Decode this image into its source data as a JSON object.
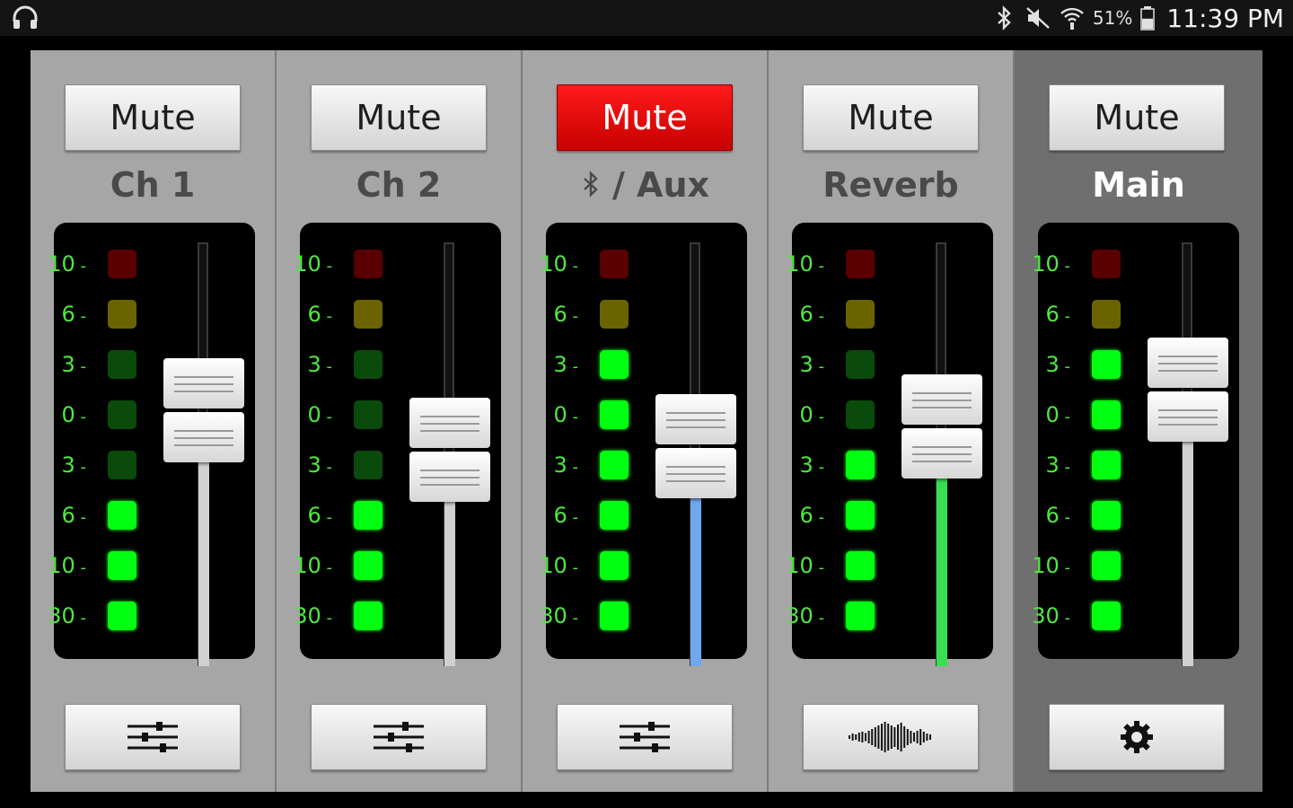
{
  "status_bar": {
    "left_icon": "headphones-icon",
    "right_icons": [
      "bluetooth-icon",
      "mute-speaker-icon",
      "wifi-icon"
    ],
    "battery_percent": "51%",
    "battery_level": 0.51,
    "time": "11:39 PM"
  },
  "meter_scale": [
    "10",
    "6",
    "3",
    "0",
    "3",
    "6",
    "10",
    "30"
  ],
  "colors": {
    "led_red_off": "#5a0000",
    "led_yellow_off": "#6b6300",
    "led_green_off": "#0a4a0a",
    "led_green_on": "#00ff10",
    "mute_active": "#e80000",
    "aux_fill": "#6fa8ee",
    "reverb_fill": "#37e04f",
    "gray_fill": "#d0d0d0"
  },
  "channels": [
    {
      "id": "ch1",
      "mute_label": "Mute",
      "muted": false,
      "label": "Ch 1",
      "leds_lit": [
        false,
        false,
        false,
        false,
        false,
        true,
        true,
        true
      ],
      "fader_level": 0.62,
      "fill_color": "gray",
      "tool_icon": "eq-sliders-icon"
    },
    {
      "id": "ch2",
      "mute_label": "Mute",
      "muted": false,
      "label": "Ch 2",
      "leds_lit": [
        false,
        false,
        false,
        false,
        false,
        true,
        true,
        true
      ],
      "fader_level": 0.5,
      "fill_color": "gray",
      "tool_icon": "eq-sliders-icon"
    },
    {
      "id": "aux",
      "mute_label": "Mute",
      "muted": true,
      "label": "/ Aux",
      "label_icon": "bluetooth-icon",
      "leds_lit": [
        false,
        false,
        true,
        true,
        true,
        true,
        true,
        true
      ],
      "fader_level": 0.51,
      "fill_color": "blue",
      "tool_icon": "eq-sliders-icon"
    },
    {
      "id": "reverb",
      "mute_label": "Mute",
      "muted": false,
      "label": "Reverb",
      "leds_lit": [
        false,
        false,
        false,
        false,
        true,
        true,
        true,
        true
      ],
      "fader_level": 0.57,
      "fill_color": "green",
      "tool_icon": "reverb-waveform-icon"
    },
    {
      "id": "main",
      "mute_label": "Mute",
      "muted": false,
      "label": "Main",
      "leds_lit": [
        false,
        false,
        true,
        true,
        true,
        true,
        true,
        true
      ],
      "fader_level": 0.68,
      "fill_color": "gray",
      "tool_icon": "settings-gear-icon"
    }
  ]
}
